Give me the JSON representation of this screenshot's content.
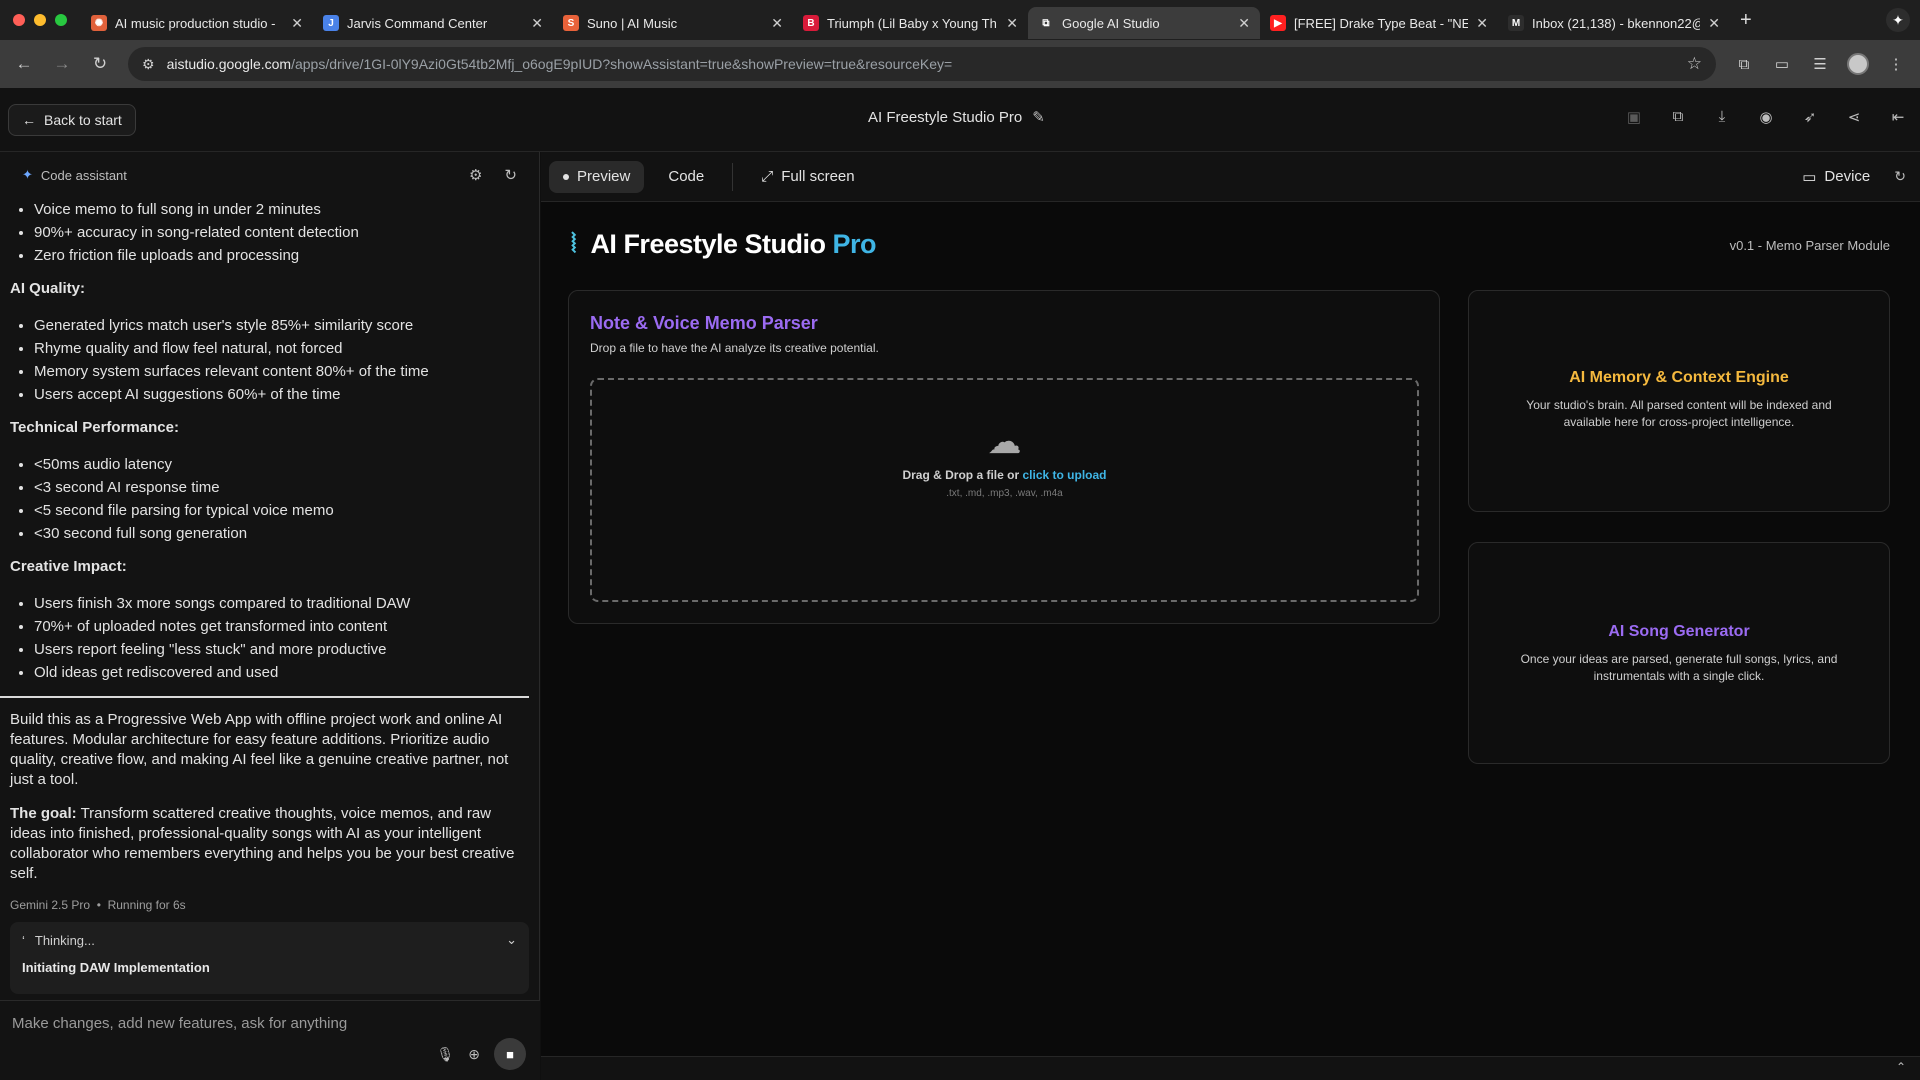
{
  "browser": {
    "tabs": [
      {
        "title": "AI music production studio - ",
        "fav_color": "#e0613b",
        "fav_glyph": "✺",
        "active": false
      },
      {
        "title": "Jarvis Command Center",
        "fav_color": "#4a82e8",
        "fav_glyph": "J",
        "active": false
      },
      {
        "title": "Suno | AI Music",
        "fav_color": "#e8623a",
        "fav_glyph": "S",
        "active": false
      },
      {
        "title": "Triumph (Lil Baby x Young Th",
        "fav_color": "#d81b3a",
        "fav_glyph": "B",
        "active": false
      },
      {
        "title": "Google AI Studio",
        "fav_color": "#3c3c3c",
        "fav_glyph": "⧉",
        "active": true
      },
      {
        "title": "[FREE] Drake Type Beat - \"NE",
        "fav_color": "#ff2020",
        "fav_glyph": "▶",
        "active": false
      },
      {
        "title": "Inbox (21,138) - bkennon22@",
        "fav_color": "#2d2d2d",
        "fav_glyph": "M",
        "active": false
      }
    ],
    "url_domain": "aistudio.google.com",
    "url_path": "/apps/drive/1GI-0lY9Azi0Gt54tb2Mfj_o6ogE9pIUD?showAssistant=true&showPreview=true&resourceKey="
  },
  "header": {
    "back_label": "Back to start",
    "app_title": "AI Freestyle Studio Pro"
  },
  "assistant": {
    "label": "Code assistant",
    "list1": [
      "Voice memo to full song in under 2 minutes",
      "90%+ accuracy in song-related content detection",
      "Zero friction file uploads and processing"
    ],
    "sec_ai_quality": "AI Quality:",
    "list2": [
      "Generated lyrics match user's style 85%+ similarity score",
      "Rhyme quality and flow feel natural, not forced",
      "Memory system surfaces relevant content 80%+ of the time",
      "Users accept AI suggestions 60%+ of the time"
    ],
    "sec_tech": "Technical Performance:",
    "list3": [
      "<50ms audio latency",
      "<3 second AI response time",
      "<5 second file parsing for typical voice memo",
      "<30 second full song generation"
    ],
    "sec_creative": "Creative Impact:",
    "list4": [
      "Users finish 3x more songs compared to traditional DAW",
      "70%+ of uploaded notes get transformed into content",
      "Users report feeling \"less stuck\" and more productive",
      "Old ideas get rediscovered and used"
    ],
    "para1": "Build this as a Progressive Web App with offline project work and online AI features. Modular architecture for easy feature additions. Prioritize audio quality, creative flow, and making AI feel like a genuine creative partner, not just a tool.",
    "goal_label": "The goal:",
    "goal_text": " Transform scattered creative thoughts, voice memos, and raw ideas into finished, professional-quality songs with AI as your intelligent collaborator who remembers everything and helps you be your best creative self.",
    "model": "Gemini 2.5 Pro",
    "running": "Running for 6s",
    "thinking": "Thinking...",
    "plan": "Initiating DAW Implementation",
    "input_placeholder": "Make changes, add new features, ask for anything"
  },
  "preview_toolbar": {
    "preview": "Preview",
    "code": "Code",
    "fullscreen": "Full screen",
    "device": "Device"
  },
  "app": {
    "brand": "AI Freestyle Studio",
    "brand_pro": "Pro",
    "version": "v0.1 - Memo Parser Module",
    "parser_title": "Note & Voice Memo Parser",
    "parser_sub": "Drop a file to have the AI analyze its creative potential.",
    "drop_text": "Drag & Drop a file or ",
    "drop_link": "click to upload",
    "drop_types": ".txt, .md, .mp3, .wav, .m4a",
    "memory_title": "AI Memory & Context Engine",
    "memory_desc": "Your studio's brain. All parsed content will be indexed and available here for cross-project intelligence.",
    "song_title": "AI Song Generator",
    "song_desc": "Once your ideas are parsed, generate full songs, lyrics, and instrumentals with a single click."
  },
  "colors": {
    "purple": "#9b6bf2",
    "gold": "#f5b93e",
    "accent_blue": "#3fb5e5"
  }
}
